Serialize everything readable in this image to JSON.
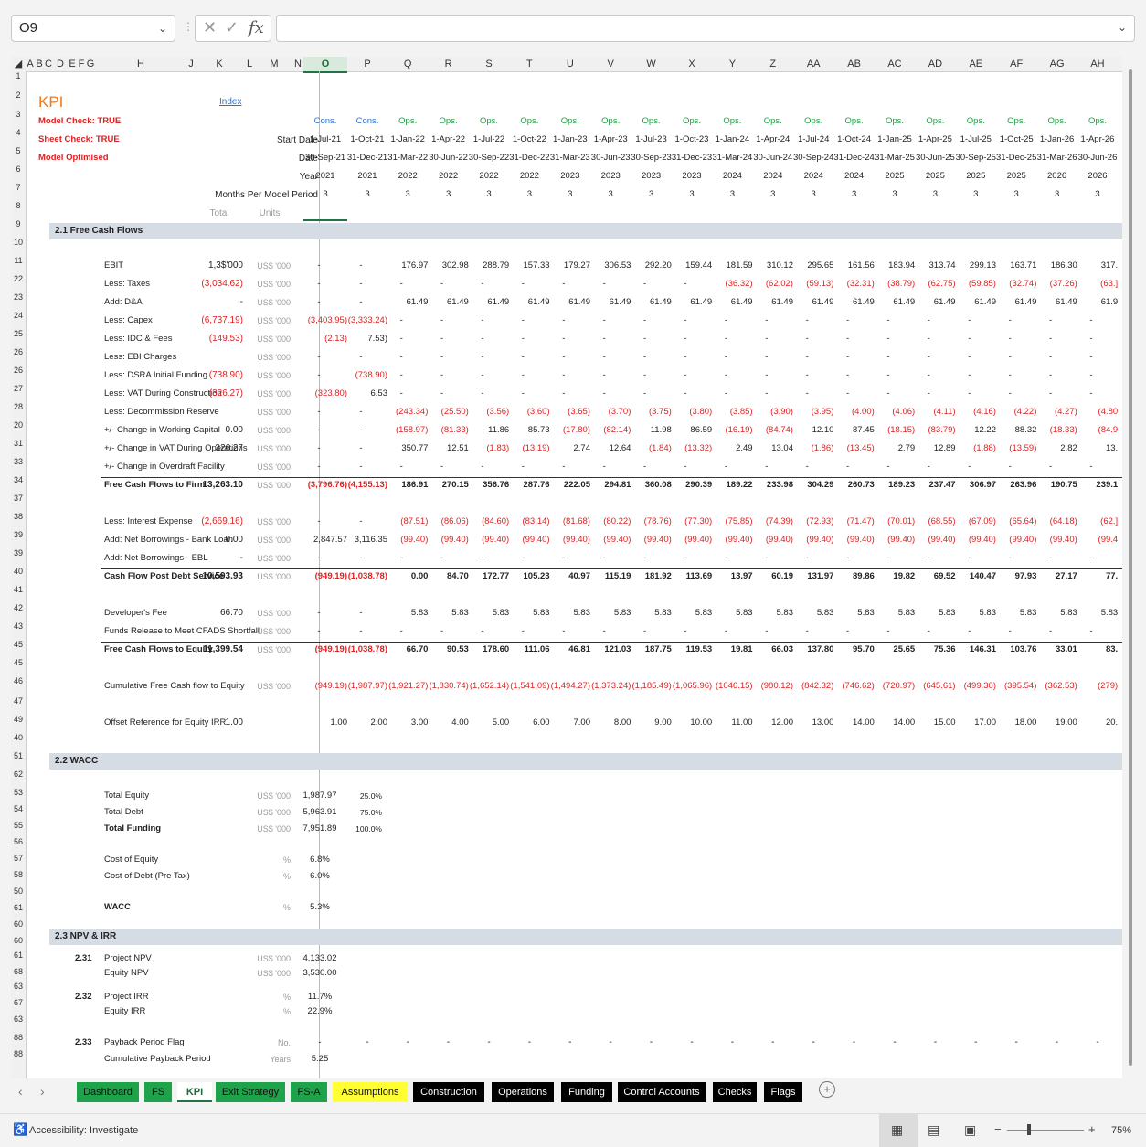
{
  "name_box": "O9",
  "formula_content": "",
  "columns": [
    "A",
    "B",
    "C",
    "D",
    "E",
    "F",
    "G",
    "H",
    "J",
    "K",
    "L",
    "M",
    "N",
    "O",
    "P",
    "Q",
    "R",
    "S",
    "T",
    "U",
    "V",
    "W",
    "X",
    "Y",
    "Z",
    "AA",
    "AB",
    "AC",
    "AD",
    "AE",
    "AF",
    "AG",
    "AH"
  ],
  "selected_column": "O",
  "sheet": {
    "title": "KPI",
    "index_link": "Index",
    "checks": [
      "Model Check: TRUE",
      "Sheet Check: TRUE",
      "Model Optimised"
    ],
    "hdr_labels": [
      "Start Date",
      "Date",
      "Year",
      "Months Per Model Period"
    ],
    "col_labels": [
      "Total",
      "Units"
    ],
    "periods": [
      {
        "type": "Cons.",
        "start": "1-Jul-21",
        "end": "30-Sep-21",
        "year": "2021",
        "months": "3"
      },
      {
        "type": "Cons.",
        "start": "1-Oct-21",
        "end": "31-Dec-21",
        "year": "2021",
        "months": "3"
      },
      {
        "type": "Ops.",
        "start": "1-Jan-22",
        "end": "31-Mar-22",
        "year": "2022",
        "months": "3"
      },
      {
        "type": "Ops.",
        "start": "1-Apr-22",
        "end": "30-Jun-22",
        "year": "2022",
        "months": "3"
      },
      {
        "type": "Ops.",
        "start": "1-Jul-22",
        "end": "30-Sep-22",
        "year": "2022",
        "months": "3"
      },
      {
        "type": "Ops.",
        "start": "1-Oct-22",
        "end": "31-Dec-22",
        "year": "2022",
        "months": "3"
      },
      {
        "type": "Ops.",
        "start": "1-Jan-23",
        "end": "31-Mar-23",
        "year": "2023",
        "months": "3"
      },
      {
        "type": "Ops.",
        "start": "1-Apr-23",
        "end": "30-Jun-23",
        "year": "2023",
        "months": "3"
      },
      {
        "type": "Ops.",
        "start": "1-Jul-23",
        "end": "30-Sep-23",
        "year": "2023",
        "months": "3"
      },
      {
        "type": "Ops.",
        "start": "1-Oct-23",
        "end": "31-Dec-23",
        "year": "2023",
        "months": "3"
      },
      {
        "type": "Ops.",
        "start": "1-Jan-24",
        "end": "31-Mar-24",
        "year": "2024",
        "months": "3"
      },
      {
        "type": "Ops.",
        "start": "1-Apr-24",
        "end": "30-Jun-24",
        "year": "2024",
        "months": "3"
      },
      {
        "type": "Ops.",
        "start": "1-Jul-24",
        "end": "30-Sep-24",
        "year": "2024",
        "months": "3"
      },
      {
        "type": "Ops.",
        "start": "1-Oct-24",
        "end": "31-Dec-24",
        "year": "2024",
        "months": "3"
      },
      {
        "type": "Ops.",
        "start": "1-Jan-25",
        "end": "31-Mar-25",
        "year": "2025",
        "months": "3"
      },
      {
        "type": "Ops.",
        "start": "1-Apr-25",
        "end": "30-Jun-25",
        "year": "2025",
        "months": "3"
      },
      {
        "type": "Ops.",
        "start": "1-Jul-25",
        "end": "30-Sep-25",
        "year": "2025",
        "months": "3"
      },
      {
        "type": "Ops.",
        "start": "1-Oct-25",
        "end": "31-Dec-25",
        "year": "2025",
        "months": "3"
      },
      {
        "type": "Ops.",
        "start": "1-Jan-26",
        "end": "31-Mar-26",
        "year": "2026",
        "months": "3"
      },
      {
        "type": "Ops.",
        "start": "1-Apr-26",
        "end": "30-Jun-26",
        "year": "2026",
        "months": "3"
      }
    ],
    "sections": {
      "fcf": "2.1  Free Cash Flows",
      "wacc": "2.2  WACC",
      "npv": "2.3  NPV & IRR"
    },
    "rows": [
      {
        "label": "EBIT",
        "total": "1,3$'000",
        "units": "US$ '000",
        "values": [
          "-",
          "-",
          "176.97",
          "302.98",
          "288.79",
          "157.33",
          "179.27",
          "306.53",
          "292.20",
          "159.44",
          "181.59",
          "310.12",
          "295.65",
          "161.56",
          "183.94",
          "313.74",
          "299.13",
          "163.71",
          "186.30",
          "317."
        ]
      },
      {
        "label": "Less: Taxes",
        "total": "(3,034.62)",
        "units": "US$ '000",
        "values": [
          "-",
          "-",
          "-",
          "-",
          "-",
          "-",
          "-",
          "-",
          "-",
          "-",
          "(36.32)",
          "(62.02)",
          "(59.13)",
          "(32.31)",
          "(38.79)",
          "(62.75)",
          "(59.85)",
          "(32.74)",
          "(37.26)",
          "(63.]"
        ]
      },
      {
        "label": "Add: D&A",
        "total": "-",
        "units": "US$ '000",
        "values": [
          "-",
          "-",
          "61.49",
          "61.49",
          "61.49",
          "61.49",
          "61.49",
          "61.49",
          "61.49",
          "61.49",
          "61.49",
          "61.49",
          "61.49",
          "61.49",
          "61.49",
          "61.49",
          "61.49",
          "61.49",
          "61.49",
          "61.9"
        ]
      },
      {
        "label": "Less: Capex",
        "total": "(6,737.19)",
        "units": "US$ '000",
        "values": [
          "(3,403.95)",
          "(3,333.24)",
          "-",
          "-",
          "-",
          "-",
          "-",
          "-",
          "-",
          "-",
          "-",
          "-",
          "-",
          "-",
          "-",
          "-",
          "-",
          "-",
          "-",
          "-"
        ]
      },
      {
        "label": "Less: IDC & Fees",
        "total": "(149.53)",
        "units": "US$ '000",
        "values": [
          "(2.13)",
          "7.53)",
          "-",
          "-",
          "-",
          "-",
          "-",
          "-",
          "-",
          "-",
          "-",
          "-",
          "-",
          "-",
          "-",
          "-",
          "-",
          "-",
          "-",
          "-"
        ]
      },
      {
        "label": "Less: EBI Charges",
        "total": "",
        "units": "US$ '000",
        "values": [
          "-",
          "-",
          "-",
          "-",
          "-",
          "-",
          "-",
          "-",
          "-",
          "-",
          "-",
          "-",
          "-",
          "-",
          "-",
          "-",
          "-",
          "-",
          "-",
          "-"
        ]
      },
      {
        "label": "Less: DSRA Initial Funding",
        "total": "(738.90)",
        "units": "US$ '000",
        "values": [
          "-",
          "(738.90)",
          "-",
          "-",
          "-",
          "-",
          "-",
          "-",
          "-",
          "-",
          "-",
          "-",
          "-",
          "-",
          "-",
          "-",
          "-",
          "-",
          "-",
          "-"
        ]
      },
      {
        "label": "Less: VAT During Construction",
        "total": "(326.27)",
        "units": "US$ '000",
        "values": [
          "(323.80)",
          "6.53",
          "-",
          "-",
          "-",
          "-",
          "-",
          "-",
          "-",
          "-",
          "-",
          "-",
          "-",
          "-",
          "-",
          "-",
          "-",
          "-",
          "-",
          "-"
        ]
      },
      {
        "label": "Less: Decommission Reserve",
        "total": "",
        "units": "US$ '000",
        "values": [
          "-",
          "-",
          "(243.34)",
          "(25.50)",
          "(3.56)",
          "(3.60)",
          "(3.65)",
          "(3.70)",
          "(3.75)",
          "(3.80)",
          "(3.85)",
          "(3.90)",
          "(3.95)",
          "(4.00)",
          "(4.06)",
          "(4.11)",
          "(4.16)",
          "(4.22)",
          "(4.27)",
          "(4.80"
        ]
      },
      {
        "label": "+/- Change in Working Capital",
        "total": "0.00",
        "units": "US$ '000",
        "values": [
          "-",
          "-",
          "(158.97)",
          "(81.33)",
          "11.86",
          "85.73",
          "(17.80)",
          "(82.14)",
          "11.98",
          "86.59",
          "(16.19)",
          "(84.74)",
          "12.10",
          "87.45",
          "(18.15)",
          "(83.79)",
          "12.22",
          "88.32",
          "(18.33)",
          "(84.9"
        ]
      },
      {
        "label": "+/- Change in VAT During Operations",
        "total": "326.27",
        "units": "US$ '000",
        "values": [
          "-",
          "-",
          "350.77",
          "12.51",
          "(1.83)",
          "(13.19)",
          "2.74",
          "12.64",
          "(1.84)",
          "(13.32)",
          "2.49",
          "13.04",
          "(1.86)",
          "(13.45)",
          "2.79",
          "12.89",
          "(1.88)",
          "(13.59)",
          "2.82",
          "13."
        ]
      },
      {
        "label": "+/- Change in Overdraft Facility",
        "total": "",
        "units": "US$ '000",
        "values": [
          "-",
          "-",
          "-",
          "-",
          "-",
          "-",
          "-",
          "-",
          "-",
          "-",
          "-",
          "-",
          "-",
          "-",
          "-",
          "-",
          "-",
          "-",
          "-",
          "-"
        ]
      },
      {
        "label": "Free Cash Flows to Firm",
        "total": "13,263.10",
        "units": "US$ '000",
        "values": [
          "(3,796.76)",
          "(4,155.13)",
          "186.91",
          "270.15",
          "356.76",
          "287.76",
          "222.05",
          "294.81",
          "360.08",
          "290.39",
          "189.22",
          "233.98",
          "304.29",
          "260.73",
          "189.23",
          "237.47",
          "306.97",
          "263.96",
          "190.75",
          "239.1"
        ]
      },
      {
        "label": "Less: Interest Expense",
        "total": "(2,669.16)",
        "units": "US$ '000",
        "values": [
          "-",
          "-",
          "(87.51)",
          "(86.06)",
          "(84.60)",
          "(83.14)",
          "(81.68)",
          "(80.22)",
          "(78.76)",
          "(77.30)",
          "(75.85)",
          "(74.39)",
          "(72.93)",
          "(71.47)",
          "(70.01)",
          "(68.55)",
          "(67.09)",
          "(65.64)",
          "(64.18)",
          "(62.]"
        ]
      },
      {
        "label": "Add: Net Borrowings - Bank Loan",
        "total": "0.00",
        "units": "US$ '000",
        "values": [
          "2,847.57",
          "3,116.35",
          "(99.40)",
          "(99.40)",
          "(99.40)",
          "(99.40)",
          "(99.40)",
          "(99.40)",
          "(99.40)",
          "(99.40)",
          "(99.40)",
          "(99.40)",
          "(99.40)",
          "(99.40)",
          "(99.40)",
          "(99.40)",
          "(99.40)",
          "(99.40)",
          "(99.40)",
          "(99.4"
        ]
      },
      {
        "label": "Add: Net Borrowings - EBL",
        "total": "-",
        "units": "US$ '000",
        "values": [
          "-",
          "-",
          "-",
          "-",
          "-",
          "-",
          "-",
          "-",
          "-",
          "-",
          "-",
          "-",
          "-",
          "-",
          "-",
          "-",
          "-",
          "-",
          "-",
          "-"
        ]
      },
      {
        "label": "Cash Flow Post Debt Service",
        "total": "10,593.93",
        "units": "US$ '000",
        "values": [
          "(949.19)",
          "(1,038.78)",
          "0.00",
          "84.70",
          "172.77",
          "105.23",
          "40.97",
          "115.19",
          "181.92",
          "113.69",
          "13.97",
          "60.19",
          "131.97",
          "89.86",
          "19.82",
          "69.52",
          "140.47",
          "97.93",
          "27.17",
          "77."
        ]
      },
      {
        "label": "Developer's Fee",
        "total": "66.70",
        "units": "US$ '000",
        "values": [
          "-",
          "-",
          "5.83",
          "5.83",
          "5.83",
          "5.83",
          "5.83",
          "5.83",
          "5.83",
          "5.83",
          "5.83",
          "5.83",
          "5.83",
          "5.83",
          "5.83",
          "5.83",
          "5.83",
          "5.83",
          "5.83",
          "5.83"
        ]
      },
      {
        "label": "Funds Release to Meet CFADS Shortfall",
        "total": "",
        "units": "US$ '000",
        "values": [
          "-",
          "-",
          "-",
          "-",
          "-",
          "-",
          "-",
          "-",
          "-",
          "-",
          "-",
          "-",
          "-",
          "-",
          "-",
          "-",
          "-",
          "-",
          "-",
          "-"
        ]
      },
      {
        "label": "Free Cash Flows to Equity",
        "total": "11,399.54",
        "units": "US$ '000",
        "values": [
          "(949.19)",
          "(1,038.78)",
          "66.70",
          "90.53",
          "178.60",
          "111.06",
          "46.81",
          "121.03",
          "187.75",
          "119.53",
          "19.81",
          "66.03",
          "137.80",
          "95.70",
          "25.65",
          "75.36",
          "146.31",
          "103.76",
          "33.01",
          "83."
        ]
      },
      {
        "label": "Cumulative Free Cash flow to Equity",
        "total": "",
        "units": "US$ '000",
        "values": [
          "(949.19)",
          "(1,987.97)",
          "(1,921.27)",
          "(1,830.74)",
          "(1,652.14)",
          "(1,541.09)",
          "(1,494.27)",
          "(1,373.24)",
          "(1,185.49)",
          "(1,065.96)",
          "(1046.15)",
          "(980.12)",
          "(842.32)",
          "(746.62)",
          "(720.97)",
          "(645.61)",
          "(499.30)",
          "(395.54)",
          "(362.53)",
          "(279)"
        ]
      },
      {
        "label": "Offset Reference for Equity IRR",
        "total": "1.00",
        "units": "",
        "values": [
          "1.00",
          "2.00",
          "3.00",
          "4.00",
          "5.00",
          "6.00",
          "7.00",
          "8.00",
          "9.00",
          "10.00",
          "11.00",
          "12.00",
          "13.00",
          "14.00",
          "14.00",
          "15.00",
          "17.00",
          "18.00",
          "19.00",
          "20."
        ]
      }
    ],
    "wacc": [
      {
        "label": "Total Equity",
        "units": "US$ '000",
        "value": "1,987.97",
        "pct": "25.0%"
      },
      {
        "label": "Total Debt",
        "units": "US$ '000",
        "value": "5,963.91",
        "pct": "75.0%"
      },
      {
        "label": "Total Funding",
        "units": "US$ '000",
        "value": "7,951.89",
        "pct": "100.0%"
      },
      {
        "label": "Cost of Equity",
        "units": "%",
        "value": "6.8%",
        "pct": ""
      },
      {
        "label": "Cost of Debt (Pre Tax)",
        "units": "%",
        "value": "6.0%",
        "pct": ""
      },
      {
        "label": "WACC",
        "units": "%",
        "value": "5.3%",
        "pct": ""
      }
    ],
    "npv": [
      {
        "num": "2.31",
        "label": "Project NPV",
        "units": "US$ '000",
        "value": "4,133.02"
      },
      {
        "num": "",
        "label": "Equity NPV",
        "units": "US$ '000",
        "value": "3,530.00"
      },
      {
        "num": "2.32",
        "label": "Project IRR",
        "units": "%",
        "value": "11.7%"
      },
      {
        "num": "",
        "label": "Equity IRR",
        "units": "%",
        "value": "22.9%"
      },
      {
        "num": "2.33",
        "label": "Payback Period Flag",
        "units": "No.",
        "value": "-"
      },
      {
        "num": "",
        "label": "Cumulative Payback Period",
        "units": "Years",
        "value": "5.25"
      }
    ]
  },
  "row_numbers": [
    "1",
    "2",
    "3",
    "4",
    "5",
    "6",
    "7",
    "8",
    "9",
    "10",
    "11",
    "22",
    "23",
    "24",
    "25",
    "26",
    "26",
    "27",
    "28",
    "20",
    "31",
    "33",
    "34",
    "37",
    "38",
    "39",
    "39",
    "40",
    "41",
    "42",
    "43",
    "45",
    "45",
    "46",
    "47",
    "49",
    "40",
    "51",
    "62",
    "53",
    "54",
    "55",
    "56",
    "57",
    "58",
    "50",
    "61",
    "60",
    "60",
    "61",
    "68",
    "63",
    "67",
    "63",
    "88",
    "88"
  ],
  "tabs": [
    {
      "label": "Dashboard",
      "bg": "#1fa34a",
      "fg": "#111111"
    },
    {
      "label": "FS",
      "bg": "#1fa34a",
      "fg": "#111111"
    },
    {
      "label": "KPI",
      "bg": "#ffffff",
      "fg": "#1d6b3a",
      "active": true
    },
    {
      "label": "Exit Strategy",
      "bg": "#1fa34a",
      "fg": "#111111"
    },
    {
      "label": "FS-A",
      "bg": "#1fa34a",
      "fg": "#111111"
    },
    {
      "label": "Assumptions",
      "bg": "#ffff33",
      "fg": "#111111"
    },
    {
      "label": "Construction",
      "bg": "#000000",
      "fg": "#ffffff"
    },
    {
      "label": "Operations",
      "bg": "#000000",
      "fg": "#ffffff"
    },
    {
      "label": "Funding",
      "bg": "#000000",
      "fg": "#ffffff"
    },
    {
      "label": "Control Accounts",
      "bg": "#000000",
      "fg": "#ffffff"
    },
    {
      "label": "Checks",
      "bg": "#000000",
      "fg": "#ffffff"
    },
    {
      "label": "Flags",
      "bg": "#000000",
      "fg": "#ffffff"
    }
  ],
  "status": {
    "accessibility": "Accessibility: Investigate",
    "zoom": "75%"
  },
  "colors": {
    "accent": "#217346",
    "negative": "#e02020",
    "cons": "#2e6fce",
    "ops": "#1e9e44",
    "title": "#f07a1a",
    "check": "#e02020",
    "band": "#d6dce4"
  }
}
